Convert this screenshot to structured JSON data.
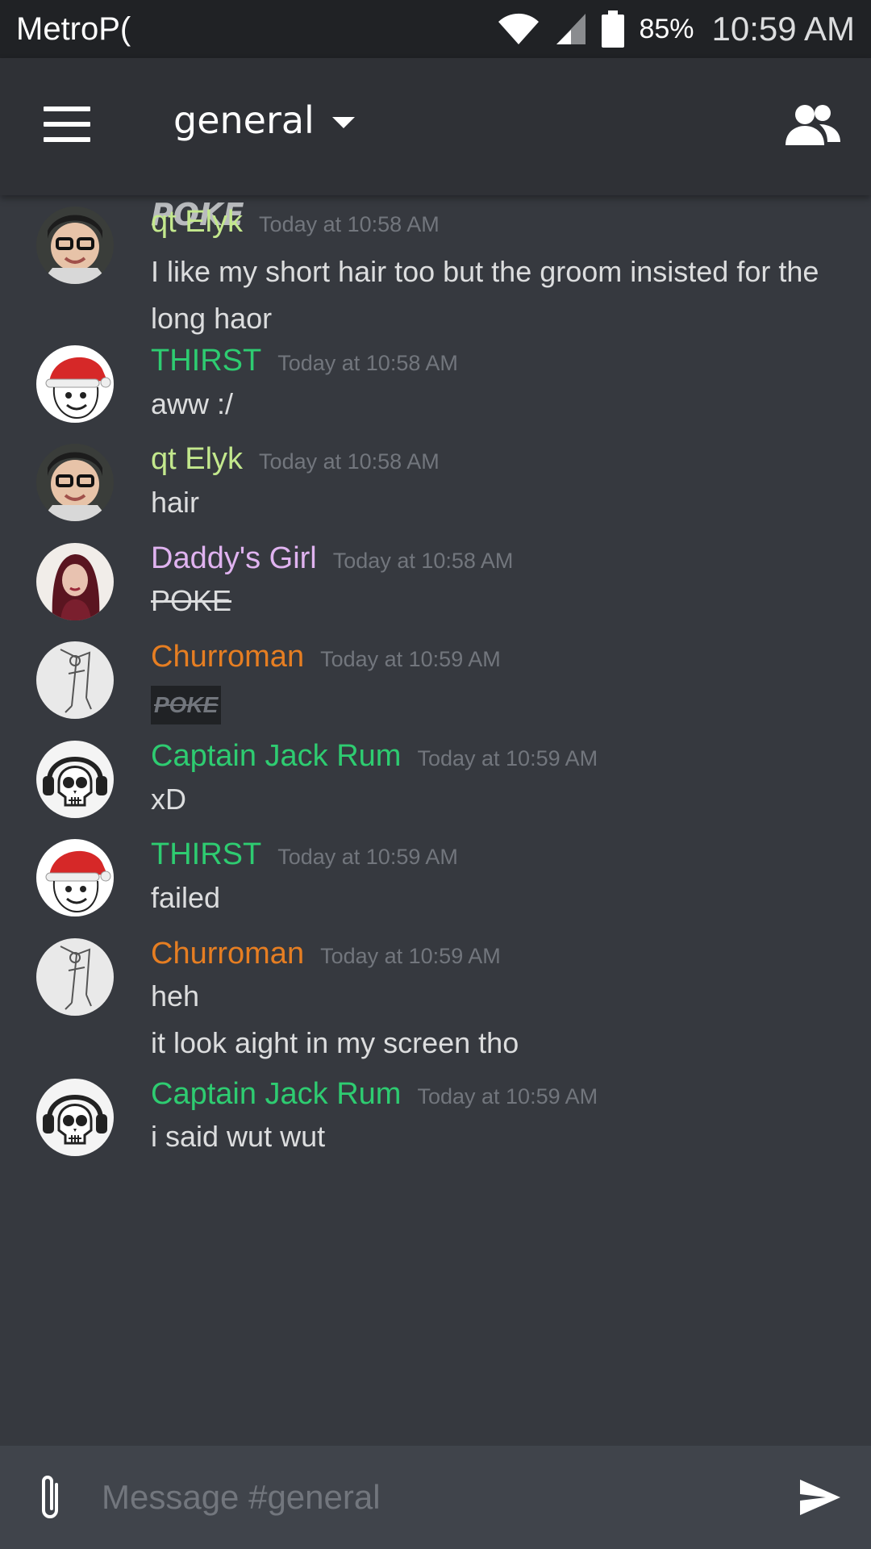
{
  "status_bar": {
    "carrier": "MetroP(",
    "battery": "85%",
    "time": "10:59 AM"
  },
  "header": {
    "channel": "general",
    "icons": {
      "menu": "hamburger-icon",
      "dropdown": "caret-down-icon",
      "members": "members-icon"
    }
  },
  "partial_top_message": "POKE",
  "messages": [
    {
      "author": "qt Elyk",
      "color": "#c3e88d",
      "timestamp": "Today at 10:58 AM",
      "lines": [
        "I like my short hair too but the groom insisted for the long haor"
      ]
    },
    {
      "author": "THIRST",
      "color": "#2ecc71",
      "timestamp": "Today at 10:58 AM",
      "lines": [
        "aww :/"
      ]
    },
    {
      "author": "qt Elyk",
      "color": "#c3e88d",
      "timestamp": "Today at 10:58 AM",
      "lines": [
        "hair"
      ]
    },
    {
      "author": "Daddy's Girl",
      "color": "#e0b3f0",
      "timestamp": "Today at 10:58 AM",
      "lines": [
        "POKE"
      ]
    },
    {
      "author": "Churroman",
      "color": "#e67e22",
      "timestamp": "Today at 10:59 AM",
      "lines": [
        "POKE"
      ]
    },
    {
      "author": "Captain Jack Rum",
      "color": "#2ecc71",
      "timestamp": "Today at 10:59 AM",
      "lines": [
        "xD"
      ]
    },
    {
      "author": "THIRST",
      "color": "#2ecc71",
      "timestamp": "Today at 10:59 AM",
      "lines": [
        "failed"
      ]
    },
    {
      "author": "Churroman",
      "color": "#e67e22",
      "timestamp": "Today at 10:59 AM",
      "lines": [
        "heh",
        "it look aight in my screen tho"
      ]
    },
    {
      "author": "Captain Jack Rum",
      "color": "#2ecc71",
      "timestamp": "Today at 10:59 AM",
      "lines": [
        "i said wut wut"
      ]
    }
  ],
  "composer": {
    "placeholder": "Message #general",
    "icons": {
      "attach": "paperclip-icon",
      "send": "send-icon"
    }
  }
}
